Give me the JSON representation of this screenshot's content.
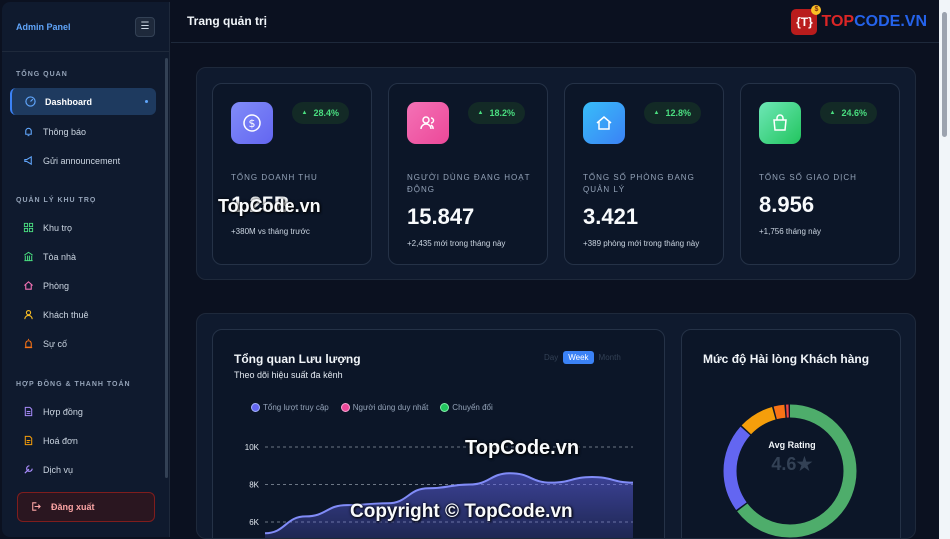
{
  "sidebar": {
    "brand": "Admin Panel",
    "sections": {
      "overview": "TỔNG QUAN",
      "management": "QUẢN LÝ KHU TRỌ",
      "contracts": "HỢP ĐỒNG & THANH TOÁN"
    },
    "items": [
      {
        "label": "Dashboard"
      },
      {
        "label": "Thông báo"
      },
      {
        "label": "Gửi announcement"
      },
      {
        "label": "Khu trọ"
      },
      {
        "label": "Tòa nhà"
      },
      {
        "label": "Phòng"
      },
      {
        "label": "Khách thuê"
      },
      {
        "label": "Sự cố"
      },
      {
        "label": "Hợp đồng"
      },
      {
        "label": "Hoá đơn"
      },
      {
        "label": "Dịch vụ"
      }
    ],
    "logout": "Đăng xuất"
  },
  "header": {
    "title": "Trang quản trị"
  },
  "watermark": {
    "logo_mark": "{T}",
    "logo_a": "TOP",
    "logo_b": "CODE.VN",
    "text1": "TopCode.vn",
    "text2": "TopCode.vn",
    "copyright": "Copyright © TopCode.vn"
  },
  "stats": [
    {
      "label": "TỔNG DOANH THU",
      "value": "1.25B",
      "sub": "+380M vs tháng trước",
      "change": "28.4%",
      "color": "#6366f1"
    },
    {
      "label": "NGƯỜI DÙNG ĐANG HOẠT ĐỘNG",
      "value": "15.847",
      "sub": "+2,435 mới trong tháng này",
      "change": "18.2%",
      "color": "#ec4899"
    },
    {
      "label": "TỔNG SỐ PHÒNG ĐANG QUẢN LÝ",
      "value": "3.421",
      "sub": "+389 phòng mới trong tháng này",
      "change": "12.8%",
      "color": "#3b82f6"
    },
    {
      "label": "TỔNG SỐ GIAO DỊCH",
      "value": "8.956",
      "sub": "+1,756 tháng này",
      "change": "24.6%",
      "color": "#22c55e"
    }
  ],
  "traffic": {
    "title": "Tổng quan Lưu lượng",
    "subtitle": "Theo dõi hiệu suất đa kênh",
    "range_tabs": [
      "Day",
      "Week",
      "Month"
    ],
    "active_tab": "Week",
    "legend": [
      {
        "name": "Tổng lượt truy cập",
        "color": "#6366f1"
      },
      {
        "name": "Người dùng duy nhất",
        "color": "#ec4899"
      },
      {
        "name": "Chuyển đổi",
        "color": "#22c55e"
      }
    ],
    "yticks": [
      "10K",
      "8K",
      "6K"
    ]
  },
  "satisfaction": {
    "title": "Mức độ Hài lòng Khách hàng",
    "center_label": "Avg Rating",
    "center_value": "4.6★"
  },
  "chart_data": [
    {
      "type": "area",
      "title": "Tổng quan Lưu lượng",
      "ylim": [
        6000,
        10000
      ],
      "yticks": [
        10000,
        8000,
        6000
      ],
      "series": [
        {
          "name": "Tổng lượt truy cập",
          "values": [
            5400,
            6300,
            6900,
            7000,
            7800,
            8000,
            8600,
            8100,
            8400,
            8100
          ]
        }
      ]
    },
    {
      "type": "pie",
      "title": "Mức độ Hài lòng Khách hàng",
      "values": [
        65,
        22,
        9,
        3,
        1
      ],
      "colors": [
        "#4ead6b",
        "#6366f1",
        "#f59e0b",
        "#f97316",
        "#ef4444"
      ]
    }
  ]
}
